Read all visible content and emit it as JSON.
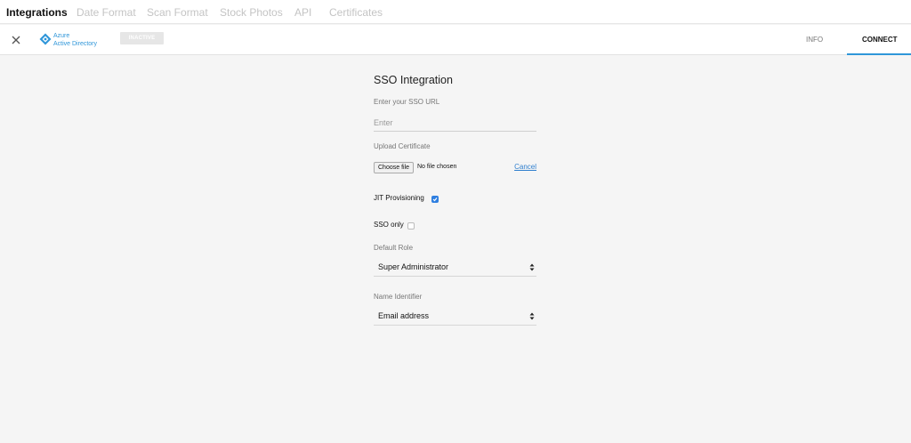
{
  "top_tabs": [
    {
      "label": "Integrations",
      "active": true
    },
    {
      "label": "Date Format",
      "active": false
    },
    {
      "label": "Scan Format",
      "active": false
    },
    {
      "label": "Stock Photos",
      "active": false
    },
    {
      "label": "API",
      "active": false
    },
    {
      "label": "Certificates",
      "active": false
    }
  ],
  "integration": {
    "brand_line1": "Azure",
    "brand_line2": "Active Directory",
    "status": "INACTIVE",
    "brand_color": "#2f96d9"
  },
  "right_tabs": [
    {
      "label": "INFO",
      "active": false
    },
    {
      "label": "CONNECT",
      "active": true
    }
  ],
  "form": {
    "title": "SSO Integration",
    "sso_url": {
      "label": "Enter your SSO URL",
      "placeholder": "Enter",
      "value": ""
    },
    "certificate": {
      "label": "Upload Certificate",
      "button": "Choose file",
      "status": "No file chosen",
      "cancel": "Cancel"
    },
    "jit": {
      "label": "JIT Provisioning",
      "checked": true
    },
    "sso_only": {
      "label": "SSO only",
      "checked": false
    },
    "default_role": {
      "label": "Default Role",
      "selected": "Super Administrator"
    },
    "name_identifier": {
      "label": "Name Identifier",
      "selected": "Email address"
    }
  },
  "colors": {
    "accent": "#2f96d9",
    "checkbox": "#2f7fe0",
    "link": "#2f7fce"
  }
}
